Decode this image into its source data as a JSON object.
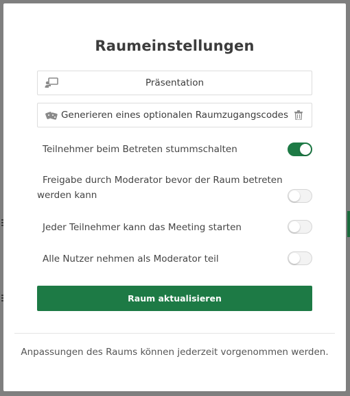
{
  "modal": {
    "title": "Raumeinstellungen",
    "presentation_label": "Präsentation",
    "access_code_label": "Generieren eines optionalen Raumzugangscodes",
    "settings": [
      {
        "label": "Teilnehmer beim Betreten stummschalten",
        "enabled": true
      },
      {
        "label": "Freigabe durch Moderator bevor der Raum betreten werden kann",
        "enabled": false
      },
      {
        "label": "Jeder Teilnehmer kann das Meeting starten",
        "enabled": false
      },
      {
        "label": "Alle Nutzer nehmen als Moderator teil",
        "enabled": false
      }
    ],
    "submit_label": "Raum aktualisieren",
    "footer_text": "Anpassungen des Raums können jederzeit vorgenommen werden."
  },
  "icons": {
    "presentation": "presentation-icon",
    "access_code": "dice-icon",
    "delete": "trash-icon"
  },
  "colors": {
    "primary": "#1d7a45",
    "overlay": "#7f7f7f",
    "toggle_off": "#f3f3f3"
  }
}
